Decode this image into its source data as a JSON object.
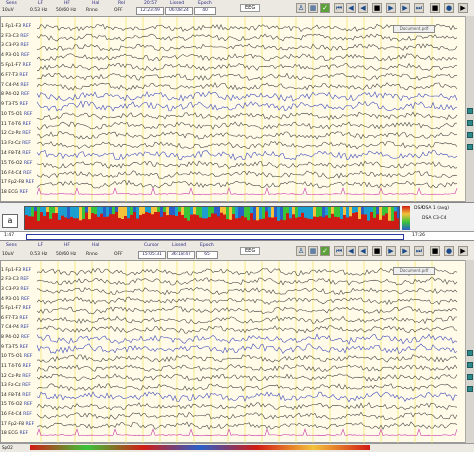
{
  "panel_a": {
    "header_labels": [
      "Sens",
      "LF",
      "HF",
      "Hal",
      "Rel",
      "20:57",
      "Lissed",
      "Epoch"
    ],
    "values": [
      "10uV",
      "0.53 Hz",
      "50/60 Hz",
      "Rnno",
      "OFF",
      "12:23:49",
      "06:08:24",
      "40"
    ],
    "eeg_label": "EEG",
    "channels": [
      {
        "num": "1",
        "name": "Fp1-F3",
        "tag": "REF"
      },
      {
        "num": "2",
        "name": "F3-C3",
        "tag": "REF"
      },
      {
        "num": "3",
        "name": "C3-P3",
        "tag": "REF"
      },
      {
        "num": "4",
        "name": "P3-O1",
        "tag": "REF"
      },
      {
        "num": "5",
        "name": "Fp1-F7",
        "tag": "REF"
      },
      {
        "num": "6",
        "name": "F7-T3",
        "tag": "REF"
      },
      {
        "num": "7",
        "name": "C4-P4",
        "tag": "REF"
      },
      {
        "num": "8",
        "name": "P4-O2",
        "tag": "REF"
      },
      {
        "num": "9",
        "name": "T3-T5",
        "tag": "REF"
      },
      {
        "num": "10",
        "name": "T5-O1",
        "tag": "REF"
      },
      {
        "num": "11",
        "name": "T4-T6",
        "tag": "REF"
      },
      {
        "num": "12",
        "name": "Cz-Pz",
        "tag": "REF"
      },
      {
        "num": "13",
        "name": "Fz-Cz",
        "tag": "REF"
      },
      {
        "num": "14",
        "name": "F8-T4",
        "tag": "REF"
      },
      {
        "num": "15",
        "name": "T6-O2",
        "tag": "REF"
      },
      {
        "num": "16",
        "name": "F4-C4",
        "tag": "REF"
      },
      {
        "num": "17",
        "name": "Fp2-F8",
        "tag": "REF"
      },
      {
        "num": "18",
        "name": "ECG",
        "tag": "REF"
      }
    ],
    "pdf_note": "Document.pdf",
    "panel_letter": "a",
    "dsa_label": "DSA",
    "dsa_meta": "DSA 1 (avg)",
    "dsa_channel": "DSA C3-C4",
    "time_left": "1:47",
    "time_right": "17:26"
  },
  "panel_b": {
    "header_labels": [
      "Sens",
      "LF",
      "HF",
      "Hal",
      "Cursor",
      "Lissed",
      "Epoch"
    ],
    "values": [
      "10uV",
      "0.53 Hz",
      "50/60 Hz",
      "Rnno",
      "OFF",
      "15:05:31",
      "36:18:47",
      "65"
    ],
    "eeg_label": "EEG",
    "pdf_note": "Document.pdf",
    "channels": [
      {
        "num": "1",
        "name": "Fp1-F3",
        "tag": "REF"
      },
      {
        "num": "2",
        "name": "F3-C3",
        "tag": "REF"
      },
      {
        "num": "3",
        "name": "C3-P3",
        "tag": "REF"
      },
      {
        "num": "4",
        "name": "P3-O1",
        "tag": "REF"
      },
      {
        "num": "5",
        "name": "Fp1-F7",
        "tag": "REF"
      },
      {
        "num": "6",
        "name": "F7-T3",
        "tag": "REF"
      },
      {
        "num": "7",
        "name": "C4-P4",
        "tag": "REF"
      },
      {
        "num": "8",
        "name": "P4-O2",
        "tag": "REF"
      },
      {
        "num": "9",
        "name": "T3-T5",
        "tag": "REF"
      },
      {
        "num": "10",
        "name": "T5-O1",
        "tag": "REF"
      },
      {
        "num": "11",
        "name": "T4-T6",
        "tag": "REF"
      },
      {
        "num": "12",
        "name": "Cz-Pz",
        "tag": "REF"
      },
      {
        "num": "13",
        "name": "Fz-Cz",
        "tag": "REF"
      },
      {
        "num": "14",
        "name": "F8-T4",
        "tag": "REF"
      },
      {
        "num": "15",
        "name": "T6-O2",
        "tag": "REF"
      },
      {
        "num": "16",
        "name": "F4-C4",
        "tag": "REF"
      },
      {
        "num": "17",
        "name": "Fp2-F8",
        "tag": "REF"
      },
      {
        "num": "18",
        "name": "ECG",
        "tag": "REF"
      }
    ],
    "status_left": "SpO2"
  },
  "toolbar_icons": [
    "person-icon",
    "grid-icon",
    "trend-icon",
    "rewind-icon",
    "prev-icon",
    "play-back-icon",
    "stop-icon",
    "play-icon",
    "next-icon",
    "forward-icon",
    "record-icon"
  ],
  "colors": {
    "trace": "#3a3a3a",
    "ecg": "#c82aa8",
    "blue_trace": "#3440b8",
    "epoch_line": "#f2e25a",
    "dsa_red": "#d01b14"
  }
}
